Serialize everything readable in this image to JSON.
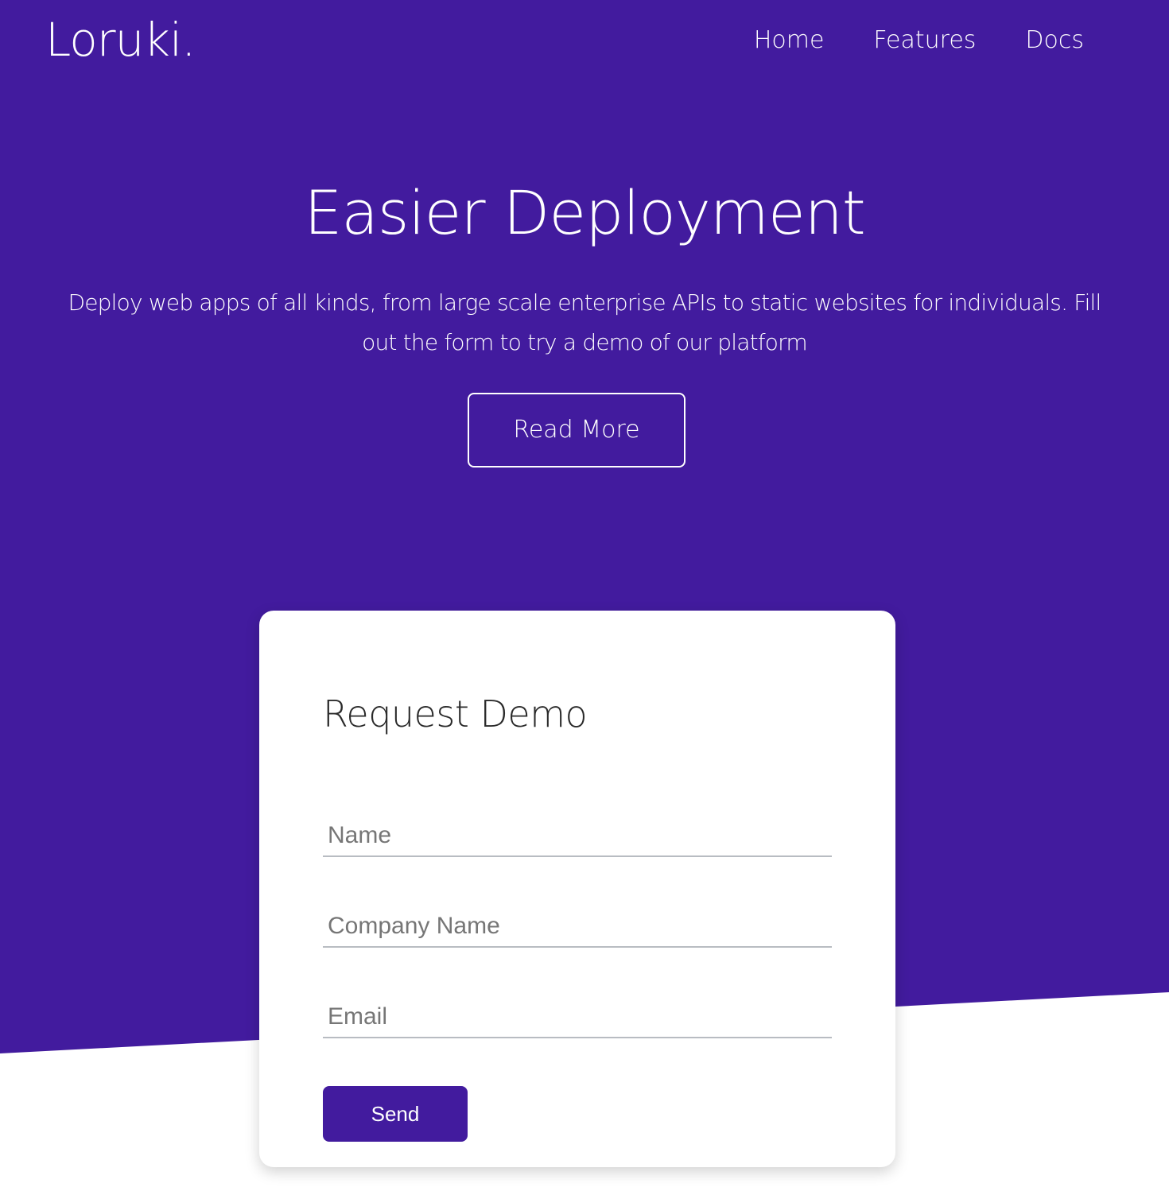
{
  "brand": {
    "logo_text": "Loruki.",
    "primary_color": "#421b9e",
    "text_on_primary": "#ffffff"
  },
  "nav": {
    "items": [
      {
        "label": "Home"
      },
      {
        "label": "Features"
      },
      {
        "label": "Docs"
      }
    ]
  },
  "hero": {
    "title": "Easier Deployment",
    "description": "Deploy web apps of all kinds, from large scale enterprise APIs to static websites for individuals. Fill out the form to try a demo of our platform",
    "cta_label": "Read More"
  },
  "demo_form": {
    "title": "Request Demo",
    "fields": [
      {
        "placeholder": "Name",
        "value": ""
      },
      {
        "placeholder": "Company Name",
        "value": ""
      },
      {
        "placeholder": "Email",
        "value": ""
      }
    ],
    "submit_label": "Send"
  }
}
